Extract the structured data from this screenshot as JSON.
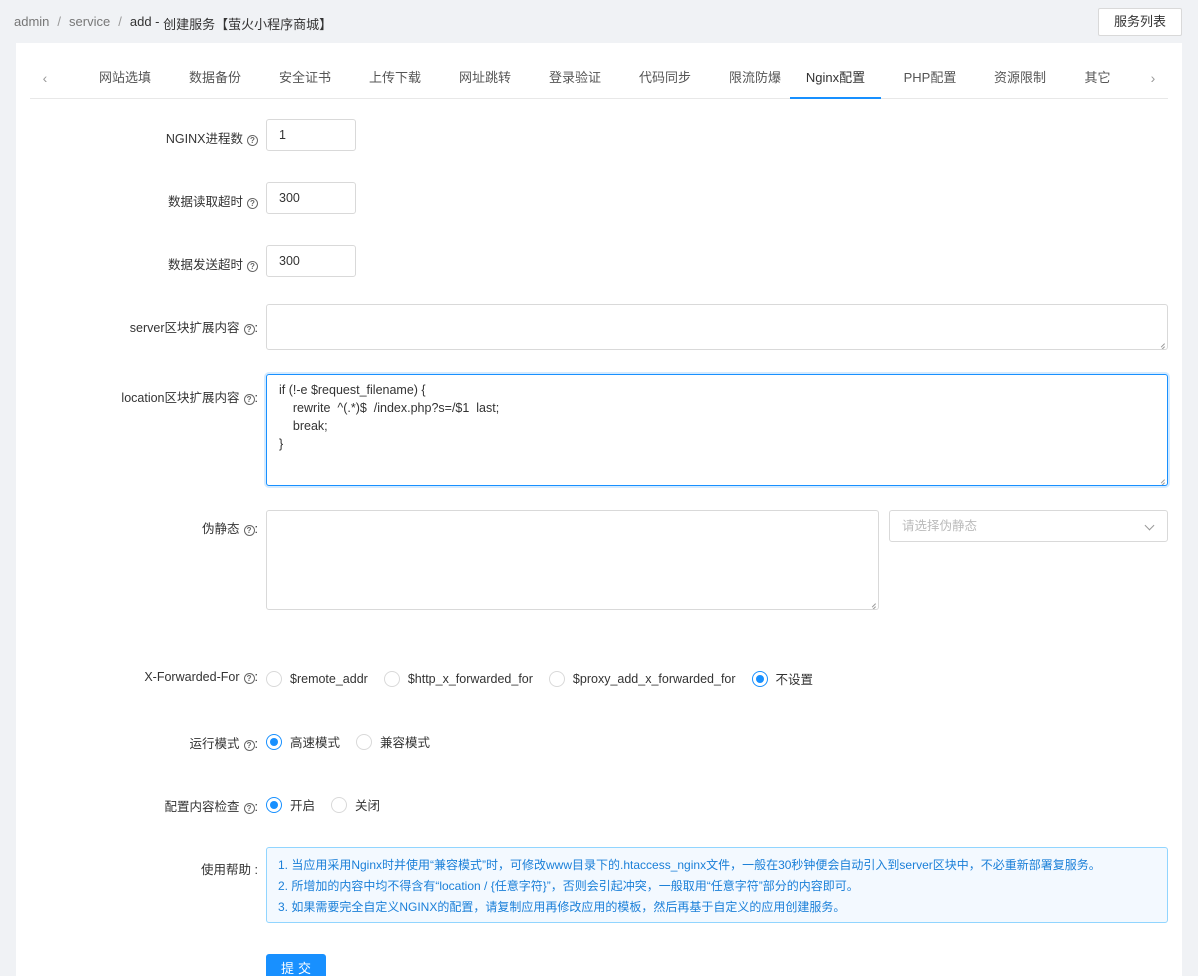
{
  "breadcrumb": [
    "admin",
    "service",
    "add",
    "创建服务【萤火小程序商城】"
  ],
  "header": {
    "list_button": "服务列表"
  },
  "tabs": [
    "网站选填",
    "数据备份",
    "安全证书",
    "上传下载",
    "网址跳转",
    "登录验证",
    "代码同步",
    "限流防爆",
    "Nginx配置",
    "PHP配置",
    "资源限制",
    "其它"
  ],
  "active_tab": "Nginx配置",
  "form": {
    "worker_processes": {
      "label": "NGINX进程数",
      "value": "1"
    },
    "read_timeout": {
      "label": "数据读取超时",
      "value": "300"
    },
    "send_timeout": {
      "label": "数据发送超时",
      "value": "300"
    },
    "server_ext": {
      "label": "server区块扩展内容",
      "value": ""
    },
    "location_ext": {
      "label": "location区块扩展内容",
      "value": "if (!-e $request_filename) {\n    rewrite  ^(.*)$  /index.php?s=/$1  last;\n    break;\n}"
    },
    "rewrite": {
      "label": "伪静态",
      "value": "",
      "select_placeholder": "请选择伪静态"
    },
    "x_forwarded_for": {
      "label": "X-Forwarded-For",
      "options": [
        "$remote_addr",
        "$http_x_forwarded_for",
        "$proxy_add_x_forwarded_for",
        "不设置"
      ],
      "selected": "不设置"
    },
    "run_mode": {
      "label": "运行模式",
      "options": [
        "高速模式",
        "兼容模式"
      ],
      "selected": "高速模式"
    },
    "config_check": {
      "label": "配置内容检查",
      "options": [
        "开启",
        "关闭"
      ],
      "selected": "开启"
    },
    "help": {
      "label": "使用帮助",
      "lines": [
        "1. 当应用采用Nginx时并使用“兼容模式”时，可修改www目录下的.htaccess_nginx文件，一般在30秒钟便会自动引入到server区块中，不必重新部署复服务。",
        "2. 所增加的内容中均不得含有“location / {任意字符}”，否则会引起冲突，一般取用“任意字符”部分的内容即可。",
        "3. 如果需要完全自定义NGINX的配置，请复制应用再修改应用的模板，然后再基于自定义的应用创建服务。"
      ]
    },
    "submit_label": "提交"
  },
  "colors": {
    "primary": "#1890ff",
    "help_text": "#1a7fd8",
    "help_bg": "#f3f9ff"
  }
}
